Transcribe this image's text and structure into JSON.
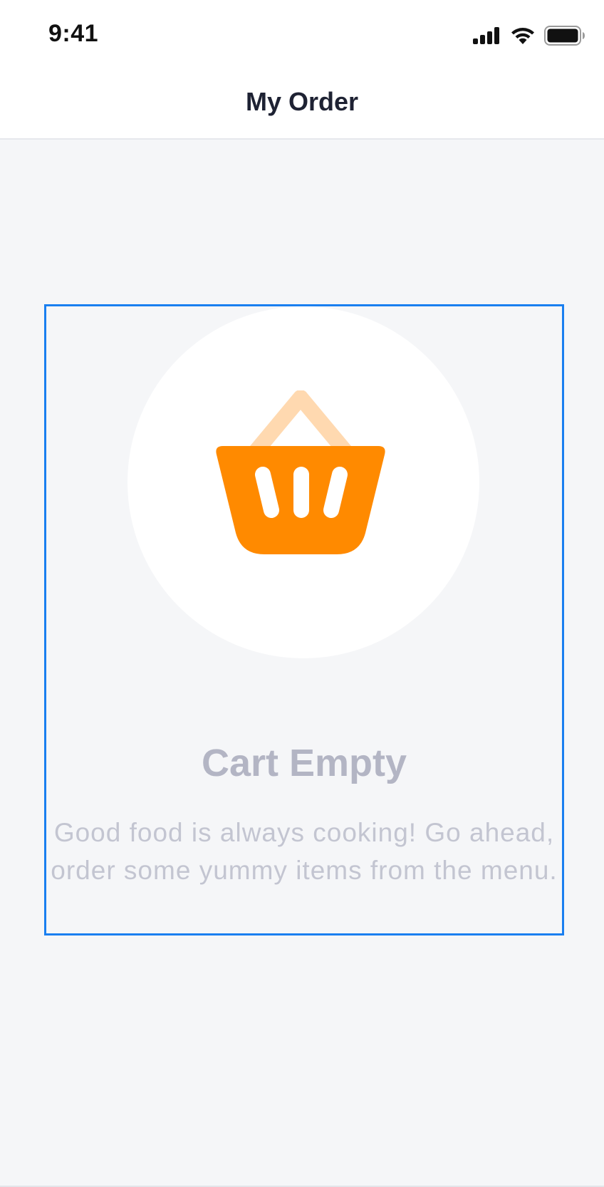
{
  "status_bar": {
    "time": "9:41",
    "icons": [
      "cellular-signal-icon",
      "wifi-icon",
      "battery-icon"
    ]
  },
  "header": {
    "title": "My Order"
  },
  "empty_state": {
    "icon": "shopping-basket-icon",
    "title": "Cart Empty",
    "message": "Good food is always cooking! Go ahead, order some yummy items from the menu."
  },
  "colors": {
    "accent_orange": "#ff8a00",
    "accent_orange_light": "#ffd9b0",
    "selection_border": "#1a7ff0",
    "title_text": "#1e2233",
    "muted_title": "#b3b5c4",
    "muted_text": "#c3c5d1",
    "background": "#f5f6f8"
  }
}
